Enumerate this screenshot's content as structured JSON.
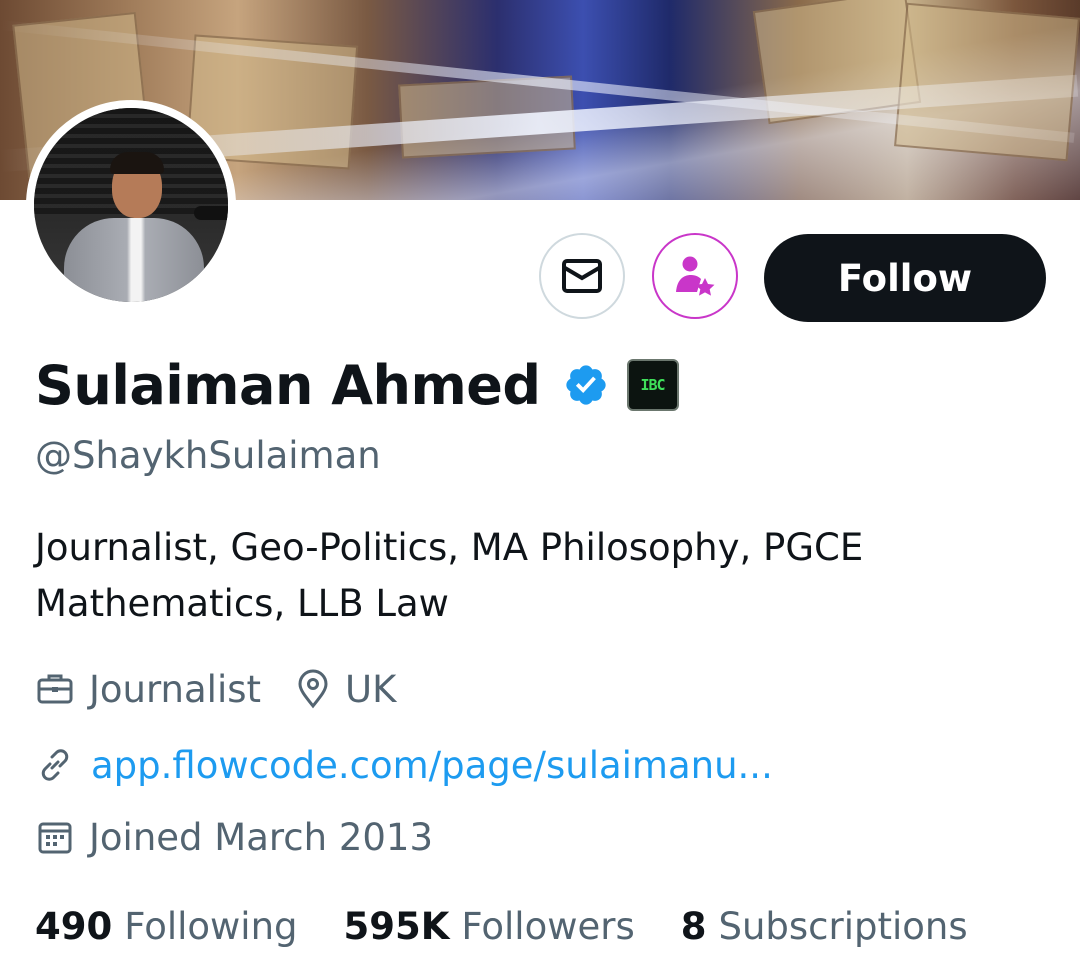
{
  "profile": {
    "display_name": "Sulaiman Ahmed",
    "handle": "@ShaykhSulaiman",
    "affiliation_badge": "IBC",
    "bio": "Journalist, Geo-Politics, MA Philosophy, PGCE Mathematics, LLB Law",
    "profession": "Journalist",
    "location": "UK",
    "website": "app.flowcode.com/page/sulaimanu...",
    "joined": "Joined March 2013"
  },
  "actions": {
    "follow_label": "Follow",
    "message_icon": "envelope-icon",
    "subscribe_icon": "subscribe-person-star-icon"
  },
  "stats": {
    "following_count": "490",
    "following_label": "Following",
    "followers_count": "595K",
    "followers_label": "Followers",
    "subscriptions_count": "8",
    "subscriptions_label": "Subscriptions"
  },
  "colors": {
    "text_primary": "#0f1419",
    "text_secondary": "#536471",
    "link": "#1d9bf0",
    "verified": "#1d9bf0",
    "subscribe_accent": "#c936c9",
    "follow_button_bg": "#0f1419"
  }
}
